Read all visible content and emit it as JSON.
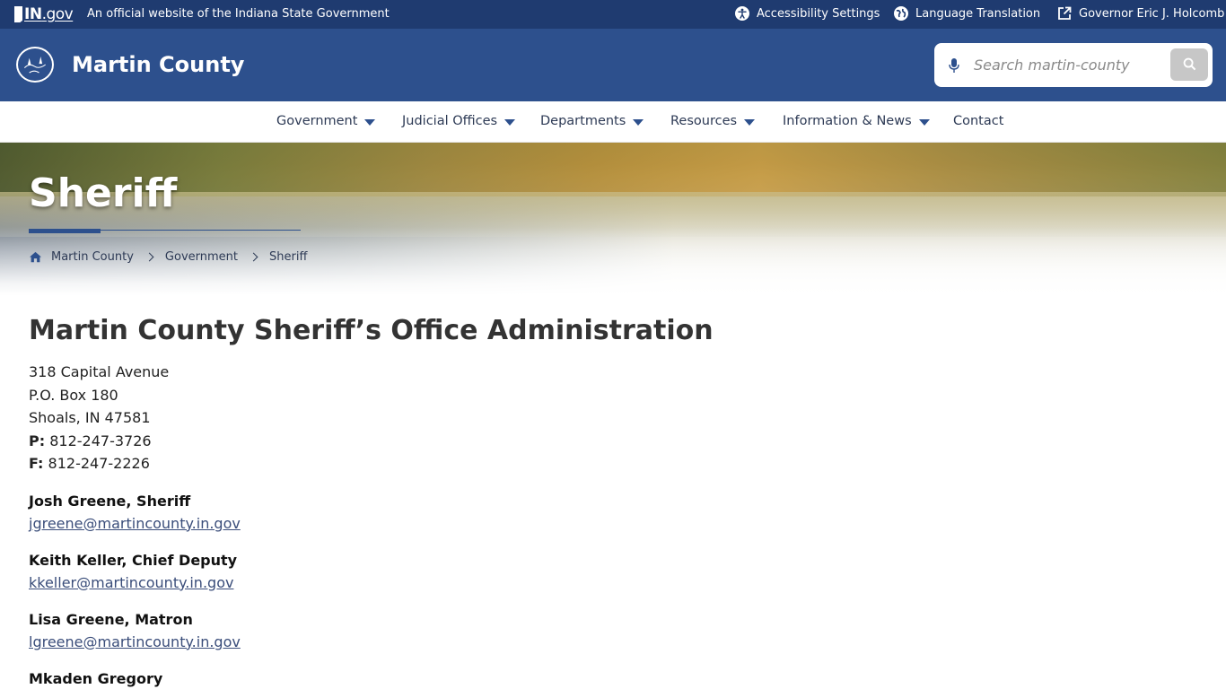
{
  "topbar": {
    "logo_in": "IN",
    "logo_gov": ".gov",
    "official_text": "An official website of the Indiana State Government",
    "accessibility": "Accessibility Settings",
    "language": "Language Translation",
    "governor": "Governor Eric J. Holcomb"
  },
  "header": {
    "site_title": "Martin County",
    "search_placeholder": "Search martin-county"
  },
  "nav": {
    "items": [
      {
        "label": "Government",
        "dropdown": true
      },
      {
        "label": "Judicial Offices",
        "dropdown": true
      },
      {
        "label": "Departments",
        "dropdown": true
      },
      {
        "label": "Resources",
        "dropdown": true
      },
      {
        "label": "Information & News",
        "dropdown": true
      },
      {
        "label": "Contact",
        "dropdown": false
      }
    ]
  },
  "hero": {
    "title": "Sheriff",
    "breadcrumbs": [
      "Martin County",
      "Government",
      "Sheriff"
    ]
  },
  "content": {
    "heading": "Martin County Sheriff’s Office Administration",
    "address": [
      "318 Capital Avenue",
      "P.O. Box 180",
      "Shoals, IN 47581"
    ],
    "phone_label": "P:",
    "phone": "812-247-3726",
    "fax_label": "F:",
    "fax": "812-247-2226",
    "staff": [
      {
        "name": "Josh Greene, Sheriff",
        "email": "jgreene@martincounty.in.gov"
      },
      {
        "name": "Keith Keller, Chief Deputy",
        "email": "kkeller@martincounty.in.gov"
      },
      {
        "name": "Lisa Greene, Matron",
        "email": "lgreene@martincounty.in.gov"
      },
      {
        "name": "Mkaden Gregory",
        "email": ""
      }
    ]
  },
  "colors": {
    "topbar": "#1f3b70",
    "header": "#2d508d",
    "accent": "#2d508d"
  }
}
